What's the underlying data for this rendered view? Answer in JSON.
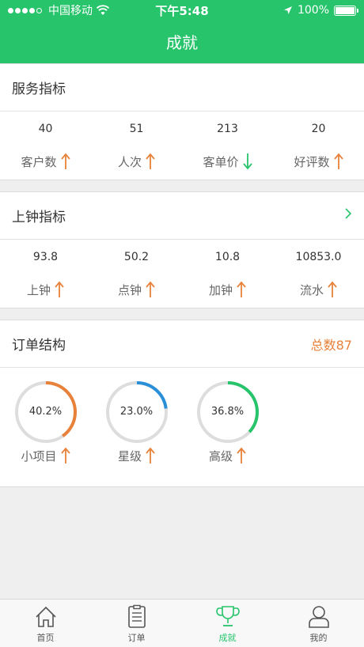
{
  "status_bar": {
    "carrier": "中国移动",
    "time": "下午5:48",
    "battery": "100%",
    "battery_level": 1.0
  },
  "header": {
    "title": "成就"
  },
  "service": {
    "title": "服务指标",
    "metrics": [
      {
        "value": "40",
        "label": "客户数",
        "trend": "up"
      },
      {
        "value": "51",
        "label": "人次",
        "trend": "up"
      },
      {
        "value": "213",
        "label": "客单价",
        "trend": "down"
      },
      {
        "value": "20",
        "label": "好评数",
        "trend": "up"
      }
    ]
  },
  "clock": {
    "title": "上钟指标",
    "metrics": [
      {
        "value": "93.8",
        "label": "上钟",
        "trend": "up"
      },
      {
        "value": "50.2",
        "label": "点钟",
        "trend": "up"
      },
      {
        "value": "10.8",
        "label": "加钟",
        "trend": "up"
      },
      {
        "value": "10853.0",
        "label": "流水",
        "trend": "up"
      }
    ]
  },
  "orders": {
    "title": "订单结构",
    "total": "总数87",
    "items": [
      {
        "percent": "40.2%",
        "ratio": 0.402,
        "color": "#e8823b",
        "label": "小项目",
        "trend": "up"
      },
      {
        "percent": "23.0%",
        "ratio": 0.23,
        "color": "#2b8fd8",
        "label": "星级",
        "trend": "up"
      },
      {
        "percent": "36.8%",
        "ratio": 0.368,
        "color": "#27c46b",
        "label": "高级",
        "trend": "up"
      }
    ]
  },
  "tabbar": {
    "tabs": [
      {
        "label": "首页",
        "icon": "home-icon",
        "active": false
      },
      {
        "label": "订单",
        "icon": "order-list-icon",
        "active": false
      },
      {
        "label": "成就",
        "icon": "trophy-icon",
        "active": true
      },
      {
        "label": "我的",
        "icon": "user-icon",
        "active": false
      }
    ]
  },
  "colors": {
    "brand": "#27c46b",
    "up": "#e8823b",
    "down": "#27c46b",
    "ring_track": "#dddddd",
    "tab_inactive": "#555555"
  }
}
